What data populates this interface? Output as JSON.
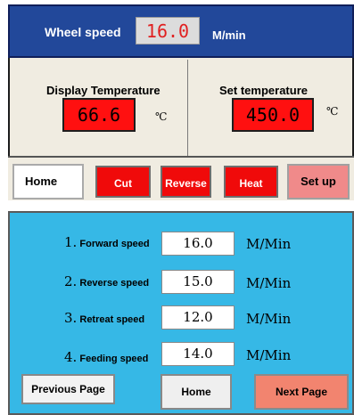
{
  "header": {
    "label": "Wheel speed",
    "value": "16.0",
    "unit": "M/min"
  },
  "temperature": {
    "display": {
      "title": "Display Temperature",
      "value": "66.6",
      "unit": "℃"
    },
    "set": {
      "title": "Set temperature",
      "value": "450.0",
      "unit": "℃"
    }
  },
  "nav": {
    "home": "Home",
    "cut": "Cut",
    "reverse": "Reverse",
    "heat": "Heat",
    "setup": "Set up"
  },
  "speeds": [
    {
      "num": "1.",
      "label": "Forward speed",
      "value": "16.0",
      "unit": "M/Min"
    },
    {
      "num": "2.",
      "label": "Reverse speed",
      "value": "15.0",
      "unit": "M/Min"
    },
    {
      "num": "3.",
      "label": "Retreat speed",
      "value": "12.0",
      "unit": "M/Min"
    },
    {
      "num": "4.",
      "label": "Feeding speed",
      "value": "14.0",
      "unit": "M/Min"
    }
  ],
  "bottom": {
    "previous": "Previous Page",
    "home": "Home",
    "next": "Next Page"
  },
  "colors": {
    "header_bg": "#22489a",
    "value_red": "#ff1010",
    "button_red": "#f00a0a",
    "setup_pink": "#f08a8a",
    "panel2_bg": "#36b8e6",
    "next_button": "#f2846f"
  }
}
